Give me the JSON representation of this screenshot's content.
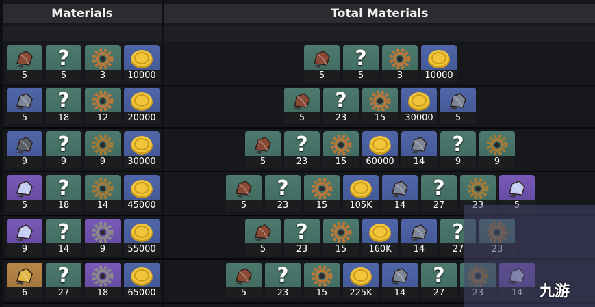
{
  "headers": {
    "materials": "Materials",
    "total_materials": "Total Materials"
  },
  "colors": {
    "green": "#4d7a6e",
    "blue": "#5066a8",
    "purple": "#7a5ab8",
    "gold": "#b8874a"
  },
  "rows": [
    {
      "materials": [
        {
          "item": "bronze-ore",
          "count": "5"
        },
        {
          "item": "unknown",
          "count": "5"
        },
        {
          "item": "bronze-gear",
          "count": "3"
        },
        {
          "item": "gold-coin",
          "count": "10000"
        }
      ],
      "total": [
        {
          "item": "bronze-ore",
          "count": "5"
        },
        {
          "item": "unknown",
          "count": "5"
        },
        {
          "item": "bronze-gear",
          "count": "3"
        },
        {
          "item": "gold-coin",
          "count": "10000"
        }
      ]
    },
    {
      "materials": [
        {
          "item": "silver-ore",
          "count": "5"
        },
        {
          "item": "unknown",
          "count": "18"
        },
        {
          "item": "bronze-gear",
          "count": "12"
        },
        {
          "item": "gold-coin",
          "count": "20000"
        }
      ],
      "total": [
        {
          "item": "bronze-ore",
          "count": "5"
        },
        {
          "item": "unknown",
          "count": "23"
        },
        {
          "item": "bronze-gear",
          "count": "15"
        },
        {
          "item": "gold-coin",
          "count": "30000"
        },
        {
          "item": "silver-ore",
          "count": "5"
        }
      ]
    },
    {
      "materials": [
        {
          "item": "dark-ore",
          "count": "9"
        },
        {
          "item": "unknown",
          "count": "9"
        },
        {
          "item": "green-gear",
          "count": "9"
        },
        {
          "item": "gold-coin",
          "count": "30000"
        }
      ],
      "total": [
        {
          "item": "bronze-ore",
          "count": "5"
        },
        {
          "item": "unknown",
          "count": "23"
        },
        {
          "item": "bronze-gear",
          "count": "15"
        },
        {
          "item": "gold-coin",
          "count": "60000"
        },
        {
          "item": "silver-ore",
          "count": "14"
        },
        {
          "item": "unknown",
          "count": "9"
        },
        {
          "item": "green-gear",
          "count": "9"
        }
      ]
    },
    {
      "materials": [
        {
          "item": "crystal-ore",
          "count": "5"
        },
        {
          "item": "unknown",
          "count": "18"
        },
        {
          "item": "green-gear",
          "count": "14"
        },
        {
          "item": "gold-coin",
          "count": "45000"
        }
      ],
      "total": [
        {
          "item": "bronze-ore",
          "count": "5"
        },
        {
          "item": "unknown",
          "count": "23"
        },
        {
          "item": "bronze-gear",
          "count": "15"
        },
        {
          "item": "gold-coin",
          "count": "105K"
        },
        {
          "item": "silver-ore",
          "count": "14"
        },
        {
          "item": "unknown",
          "count": "27"
        },
        {
          "item": "green-gear",
          "count": "23"
        },
        {
          "item": "crystal-ore",
          "count": "5"
        }
      ]
    },
    {
      "materials": [
        {
          "item": "crystal-ore",
          "count": "9"
        },
        {
          "item": "unknown",
          "count": "14"
        },
        {
          "item": "silver-gear",
          "count": "9"
        },
        {
          "item": "gold-coin",
          "count": "55000"
        }
      ],
      "total": [
        {
          "item": "bronze-ore",
          "count": "5"
        },
        {
          "item": "unknown",
          "count": "23"
        },
        {
          "item": "bronze-gear",
          "count": "15"
        },
        {
          "item": "gold-coin",
          "count": "160K"
        },
        {
          "item": "silver-ore",
          "count": "14"
        },
        {
          "item": "unknown",
          "count": "27"
        },
        {
          "item": "green-gear",
          "count": "23"
        }
      ]
    },
    {
      "materials": [
        {
          "item": "gold-ore",
          "count": "6"
        },
        {
          "item": "unknown",
          "count": "27"
        },
        {
          "item": "silver-gear",
          "count": "18"
        },
        {
          "item": "gold-coin",
          "count": "65000"
        }
      ],
      "total": [
        {
          "item": "bronze-ore",
          "count": "5"
        },
        {
          "item": "unknown",
          "count": "23"
        },
        {
          "item": "bronze-gear",
          "count": "15"
        },
        {
          "item": "gold-coin",
          "count": "225K"
        },
        {
          "item": "silver-ore",
          "count": "14"
        },
        {
          "item": "unknown",
          "count": "27"
        },
        {
          "item": "green-gear",
          "count": "23"
        },
        {
          "item": "crystal-ore",
          "count": "14"
        }
      ]
    }
  ],
  "watermark": {
    "text": "九游"
  }
}
